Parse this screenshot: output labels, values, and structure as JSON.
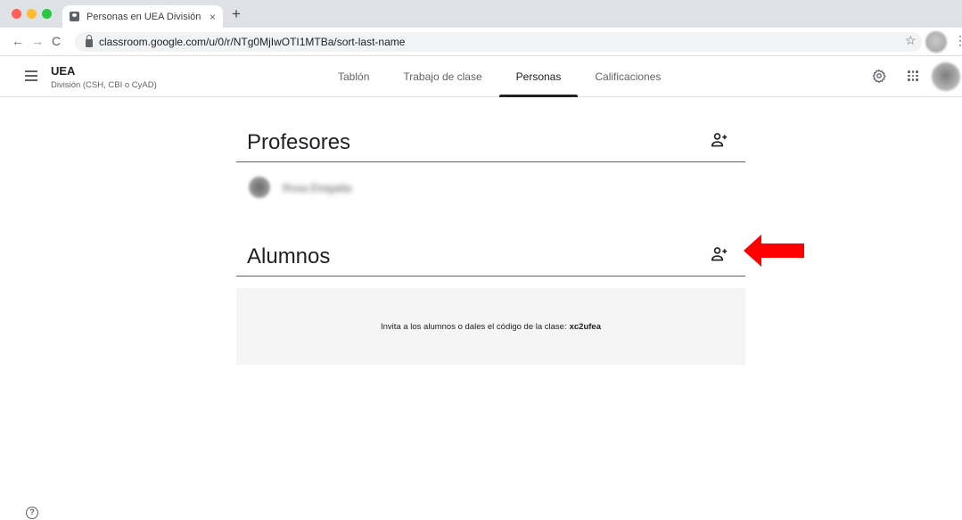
{
  "browser": {
    "tab_title": "Personas en UEA División (CSH",
    "tab_close": "×",
    "new_tab": "+",
    "back": "←",
    "forward": "→",
    "reload": "C",
    "url": "classroom.google.com/u/0/r/NTg0MjIwOTI1MTBa/sort-last-name",
    "bookmark": "☆",
    "menu": "⋮"
  },
  "header": {
    "class_name": "UEA",
    "class_section": "División (CSH, CBI o CyAD)",
    "tabs": [
      {
        "label": "Tablón",
        "active": false
      },
      {
        "label": "Trabajo de clase",
        "active": false
      },
      {
        "label": "Personas",
        "active": true
      },
      {
        "label": "Calificaciones",
        "active": false
      }
    ]
  },
  "teachers": {
    "title": "Profesores",
    "list": [
      {
        "name": "Rosa Elvigatta"
      }
    ]
  },
  "students": {
    "title": "Alumnos",
    "invite_text": "Invita a los alumnos o dales el código de la clase:",
    "class_code": "xc2ufea"
  },
  "help": {
    "label": "?"
  },
  "colors": {
    "accent": "#202124",
    "arrow": "#ff0000",
    "tabstrip": "#dee1e6",
    "invite_bg": "#f5f5f5"
  },
  "icons": {
    "menu": "hamburger-icon",
    "settings": "gear-icon",
    "apps": "apps-grid-icon",
    "add_person": "person-add-icon",
    "help": "help-icon"
  }
}
